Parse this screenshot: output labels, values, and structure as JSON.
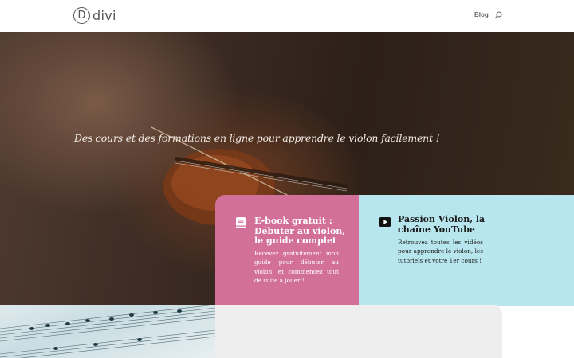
{
  "header": {
    "logo_letter": "D",
    "logo_text": "divi",
    "nav_blog": "Blog"
  },
  "hero": {
    "tagline": "Des cours et des formations en ligne pour apprendre le violon facilement !"
  },
  "cards": [
    {
      "title": "E-book gratuit : Débuter au violon, le guide complet",
      "text": "Recevez gratuitement mon guide pour débuter au violon, et commencez tout de suite à jouer !",
      "icon": "book-icon",
      "color": "#d2709a"
    },
    {
      "title": "Passion Violon, la chaîne YouTube",
      "text": "Retrouvez toutes les vidéos pour apprendre le violon, les tutoriels et votre 1er cours !",
      "icon": "youtube-icon",
      "color": "#b8e6ef"
    }
  ],
  "colors": {
    "grey_section": "#eeeeee"
  }
}
